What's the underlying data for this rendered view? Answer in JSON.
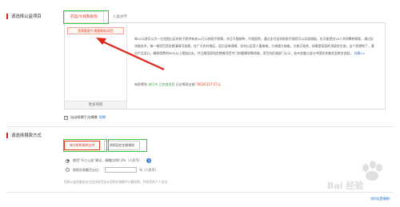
{
  "project_section": {
    "title": "请选择公益项目",
    "tabs": [
      {
        "label": "药品/大病救助等"
      },
      {
        "label": "儿童关怀"
      }
    ],
    "selected_item": "您需要照片/需要救助/项目",
    "more_button": "更多项目",
    "description": "每10元就可以为一位贫困山区的孩子提供有效10万元的医疗保障，并且不限病种，不限医院，通过支付宝扶助医疗保险可以实现理赔。也可能是由10人共同筹款帮助，通过区块链技术，每一笔项目资金都清晰可追溯，在广大农村地区，因为没有保障，农村山区家人看病难，大病就大病难，大病又致贫，如果是家庭的顶梁柱生病，这个家就垮了，通过产品设计，确保保费的90%以上理赔出去，并注册国家指定慈善项目专门的健康保障地域，项目由民政部门公示，杭州金融公益与中国扶贫基金会联合发起。",
    "more_link": "详情>>",
    "status_prefix": "每款筹款",
    "status_progress": "进行中",
    "status_mid": "已完成项目",
    "status_total_label": "历史筹款金额",
    "status_total": "76526127.57元"
  },
  "option": {
    "checkbox_label": "自动续期下次捐赠",
    "checkbox_link": "续期",
    "checked_mark": "✓"
  },
  "donation_section": {
    "title": "请选择捐款方式",
    "modes": [
      {
        "label": "每次按照捐款比例"
      },
      {
        "label": "按照固定金额捐款"
      }
    ],
    "radio1": "使用“不二公益”建议，捐赠比例0.3%（人民币）",
    "radio2_label": "按照交易额百分比：",
    "radio2_unit": "%（人民币）",
    "tip": "您的公益贡献由支付宝扶贫资金从您的交易额中计算扣除，并非您的个人支出",
    "help": "?",
    "bottom_link": "如何设置捐赠?"
  },
  "watermark": "Bai 经验"
}
